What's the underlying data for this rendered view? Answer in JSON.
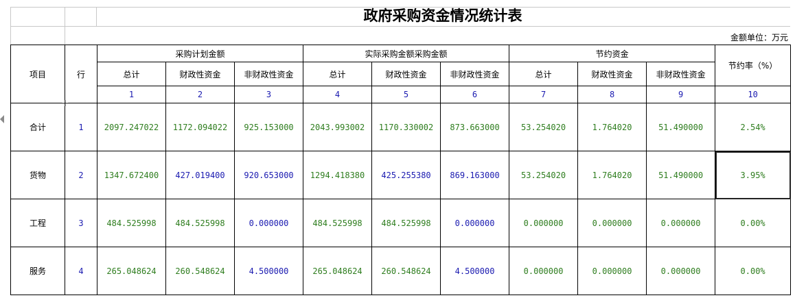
{
  "title": "政府采购资金情况统计表",
  "unit_label": "金额单位：万元",
  "headers": {
    "item": "项目",
    "row": "行",
    "group_plan": "采购计划金额",
    "group_actual": "实际采购金额采购金额",
    "group_saving": "节约资金",
    "saving_rate": "节约率（%）",
    "sub": [
      "总计",
      "财政性资金",
      "非财政性资金",
      "总计",
      "财政性资金",
      "非财政性资金",
      "总计",
      "财政性资金",
      "非财政性资金"
    ],
    "col_numbers": [
      "1",
      "2",
      "3",
      "4",
      "5",
      "6",
      "7",
      "8",
      "9",
      "10"
    ]
  },
  "rows": [
    {
      "item": "合计",
      "row": "1",
      "values": [
        "2097.247022",
        "1172.094022",
        "925.153000",
        "2043.993002",
        "1170.330002",
        "873.663000",
        "53.254020",
        "1.764020",
        "51.490000",
        "2.54%"
      ]
    },
    {
      "item": "货物",
      "row": "2",
      "values": [
        "1347.672400",
        "427.019400",
        "920.653000",
        "1294.418380",
        "425.255380",
        "869.163000",
        "53.254020",
        "1.764020",
        "51.490000",
        "3.95%"
      ]
    },
    {
      "item": "工程",
      "row": "3",
      "values": [
        "484.525998",
        "484.525998",
        "0.000000",
        "484.525998",
        "484.525998",
        "0.000000",
        "0.000000",
        "0.000000",
        "0.000000",
        "0.00%"
      ]
    },
    {
      "item": "服务",
      "row": "4",
      "values": [
        "265.048624",
        "260.548624",
        "4.500000",
        "265.048624",
        "260.548624",
        "4.500000",
        "0.000000",
        "0.000000",
        "0.000000",
        "0.00%"
      ]
    }
  ],
  "colors": {
    "green": "#2e7d1e",
    "blue": "#1a1ab0"
  }
}
